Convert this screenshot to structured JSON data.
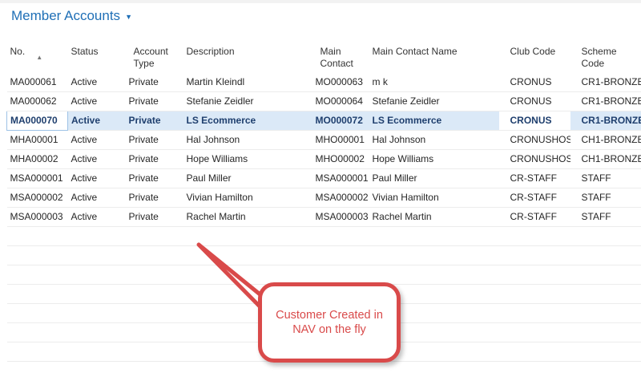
{
  "page": {
    "title": "Member Accounts"
  },
  "columns": [
    "No.",
    "Status",
    "Account Type",
    "Description",
    "Main Contact",
    "Main Contact Name",
    "Club Code",
    "Scheme Code"
  ],
  "rows": [
    [
      "MA000061",
      "Active",
      "Private",
      "Martin Kleindl",
      "MO000063",
      "m k",
      "CRONUS",
      "CR1-BRONZE"
    ],
    [
      "MA000062",
      "Active",
      "Private",
      "Stefanie Zeidler",
      "MO000064",
      "Stefanie Zeidler",
      "CRONUS",
      "CR1-BRONZE"
    ],
    [
      "MA000070",
      "Active",
      "Private",
      "LS Ecommerce",
      "MO000072",
      "LS Ecommerce",
      "CRONUS",
      "CR1-BRONZE"
    ],
    [
      "MHA00001",
      "Active",
      "Private",
      "Hal Johnson",
      "MHO00001",
      "Hal Johnson",
      "CRONUSHOSP",
      "CH1-BRONZE"
    ],
    [
      "MHA00002",
      "Active",
      "Private",
      "Hope Williams",
      "MHO00002",
      "Hope Williams",
      "CRONUSHOSP",
      "CH1-BRONZE"
    ],
    [
      "MSA000001",
      "Active",
      "Private",
      "Paul Miller",
      "MSA000001",
      "Paul Miller",
      "CR-STAFF",
      "STAFF"
    ],
    [
      "MSA000002",
      "Active",
      "Private",
      "Vivian Hamilton",
      "MSA000002",
      "Vivian Hamilton",
      "CR-STAFF",
      "STAFF"
    ],
    [
      "MSA000003",
      "Active",
      "Private",
      "Rachel Martin",
      "MSA000003",
      "Rachel Martin",
      "CR-STAFF",
      "STAFF"
    ]
  ],
  "callout": {
    "line1": "Customer Created in",
    "line2": "NAV on the fly"
  },
  "colors": {
    "title": "#1f6fb6",
    "callout": "#d94a4a",
    "selection": "#dbe9f7"
  },
  "icons": {
    "title_menu": "chevron-down-icon",
    "sort": "sort-ascending-icon"
  }
}
